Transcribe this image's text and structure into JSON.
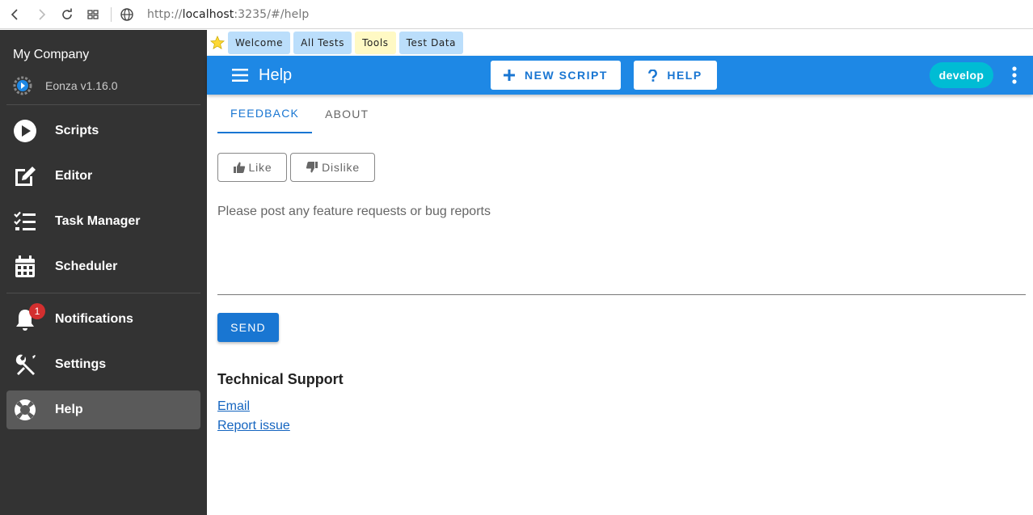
{
  "browser": {
    "url_prefix": "http://",
    "url_host": "localhost",
    "url_rest": ":3235/#/help"
  },
  "sidebar": {
    "company": "My Company",
    "version": "Eonza v1.16.0",
    "items": [
      {
        "label": "Scripts"
      },
      {
        "label": "Editor"
      },
      {
        "label": "Task Manager"
      },
      {
        "label": "Scheduler"
      },
      {
        "label": "Notifications",
        "badge": "1"
      },
      {
        "label": "Settings"
      },
      {
        "label": "Help"
      }
    ]
  },
  "bookmarks": [
    {
      "label": "Welcome",
      "color": "#bbdefb"
    },
    {
      "label": "All Tests",
      "color": "#bbdefb"
    },
    {
      "label": "Tools",
      "color": "#fff9c4"
    },
    {
      "label": "Test Data",
      "color": "#bbdefb"
    }
  ],
  "appbar": {
    "title": "Help",
    "new_script": "NEW SCRIPT",
    "help": "HELP",
    "branch": "develop"
  },
  "tabs": [
    {
      "label": "FEEDBACK",
      "active": true
    },
    {
      "label": "ABOUT",
      "active": false
    }
  ],
  "feedback": {
    "like": "Like",
    "dislike": "Dislike",
    "placeholder": "Please post any feature requests or bug reports",
    "send": "SEND"
  },
  "support": {
    "title": "Technical Support",
    "email": "Email",
    "report": "Report issue"
  },
  "colors": {
    "primary": "#1e88e5",
    "accent": "#1976d2",
    "sidebar_bg": "#333333",
    "chip": "#00bcd4"
  }
}
